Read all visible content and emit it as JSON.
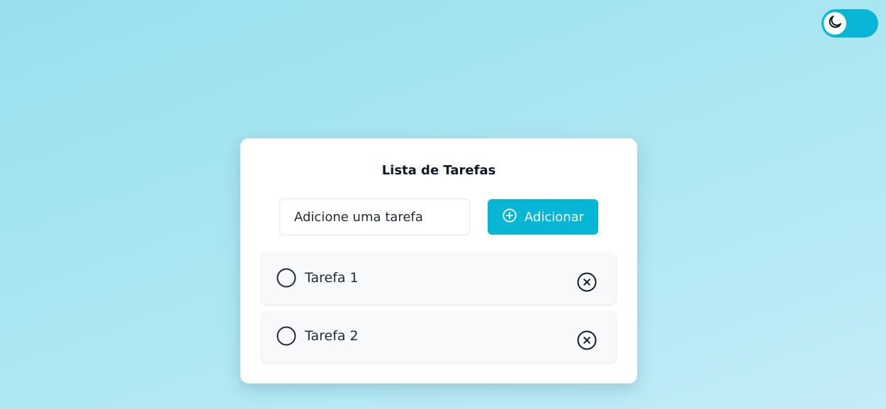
{
  "theme_toggle": {
    "icon": "moon-icon",
    "state": "light"
  },
  "card": {
    "title": "Lista de Tarefas",
    "input": {
      "placeholder": "Adicione uma tarefa",
      "value": ""
    },
    "add_button": {
      "label": "Adicionar",
      "icon": "plus-circle-icon"
    },
    "tasks": [
      {
        "label": "Tarefa 1",
        "completed": false
      },
      {
        "label": "Tarefa 2",
        "completed": false
      }
    ]
  },
  "colors": {
    "accent": "#06b6d4",
    "card_background": "#ffffff",
    "task_background": "#f8f9fb",
    "text": "#1f2937"
  }
}
